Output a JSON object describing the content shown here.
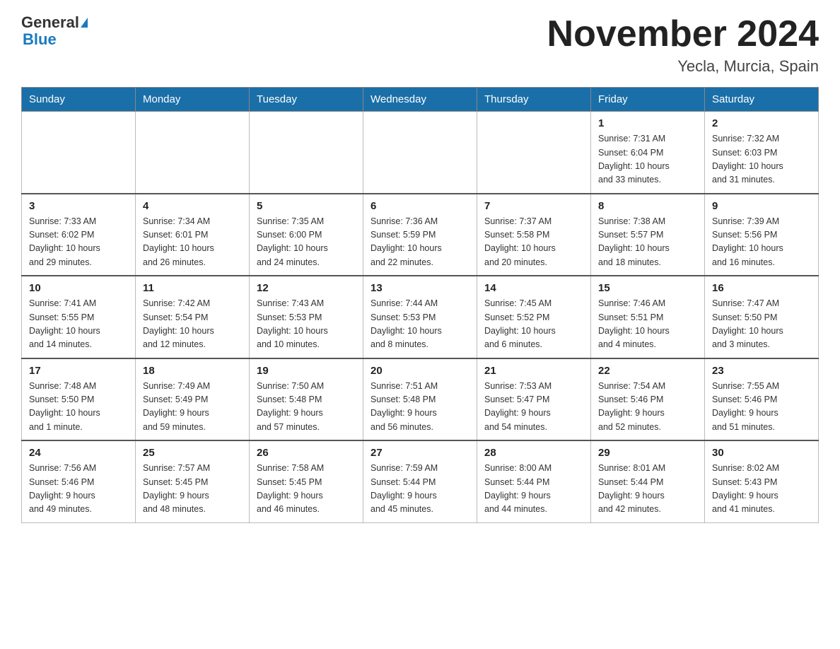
{
  "header": {
    "logo_general": "General",
    "logo_blue": "Blue",
    "month_title": "November 2024",
    "location": "Yecla, Murcia, Spain"
  },
  "weekdays": [
    "Sunday",
    "Monday",
    "Tuesday",
    "Wednesday",
    "Thursday",
    "Friday",
    "Saturday"
  ],
  "weeks": [
    [
      {
        "day": "",
        "info": ""
      },
      {
        "day": "",
        "info": ""
      },
      {
        "day": "",
        "info": ""
      },
      {
        "day": "",
        "info": ""
      },
      {
        "day": "",
        "info": ""
      },
      {
        "day": "1",
        "info": "Sunrise: 7:31 AM\nSunset: 6:04 PM\nDaylight: 10 hours\nand 33 minutes."
      },
      {
        "day": "2",
        "info": "Sunrise: 7:32 AM\nSunset: 6:03 PM\nDaylight: 10 hours\nand 31 minutes."
      }
    ],
    [
      {
        "day": "3",
        "info": "Sunrise: 7:33 AM\nSunset: 6:02 PM\nDaylight: 10 hours\nand 29 minutes."
      },
      {
        "day": "4",
        "info": "Sunrise: 7:34 AM\nSunset: 6:01 PM\nDaylight: 10 hours\nand 26 minutes."
      },
      {
        "day": "5",
        "info": "Sunrise: 7:35 AM\nSunset: 6:00 PM\nDaylight: 10 hours\nand 24 minutes."
      },
      {
        "day": "6",
        "info": "Sunrise: 7:36 AM\nSunset: 5:59 PM\nDaylight: 10 hours\nand 22 minutes."
      },
      {
        "day": "7",
        "info": "Sunrise: 7:37 AM\nSunset: 5:58 PM\nDaylight: 10 hours\nand 20 minutes."
      },
      {
        "day": "8",
        "info": "Sunrise: 7:38 AM\nSunset: 5:57 PM\nDaylight: 10 hours\nand 18 minutes."
      },
      {
        "day": "9",
        "info": "Sunrise: 7:39 AM\nSunset: 5:56 PM\nDaylight: 10 hours\nand 16 minutes."
      }
    ],
    [
      {
        "day": "10",
        "info": "Sunrise: 7:41 AM\nSunset: 5:55 PM\nDaylight: 10 hours\nand 14 minutes."
      },
      {
        "day": "11",
        "info": "Sunrise: 7:42 AM\nSunset: 5:54 PM\nDaylight: 10 hours\nand 12 minutes."
      },
      {
        "day": "12",
        "info": "Sunrise: 7:43 AM\nSunset: 5:53 PM\nDaylight: 10 hours\nand 10 minutes."
      },
      {
        "day": "13",
        "info": "Sunrise: 7:44 AM\nSunset: 5:53 PM\nDaylight: 10 hours\nand 8 minutes."
      },
      {
        "day": "14",
        "info": "Sunrise: 7:45 AM\nSunset: 5:52 PM\nDaylight: 10 hours\nand 6 minutes."
      },
      {
        "day": "15",
        "info": "Sunrise: 7:46 AM\nSunset: 5:51 PM\nDaylight: 10 hours\nand 4 minutes."
      },
      {
        "day": "16",
        "info": "Sunrise: 7:47 AM\nSunset: 5:50 PM\nDaylight: 10 hours\nand 3 minutes."
      }
    ],
    [
      {
        "day": "17",
        "info": "Sunrise: 7:48 AM\nSunset: 5:50 PM\nDaylight: 10 hours\nand 1 minute."
      },
      {
        "day": "18",
        "info": "Sunrise: 7:49 AM\nSunset: 5:49 PM\nDaylight: 9 hours\nand 59 minutes."
      },
      {
        "day": "19",
        "info": "Sunrise: 7:50 AM\nSunset: 5:48 PM\nDaylight: 9 hours\nand 57 minutes."
      },
      {
        "day": "20",
        "info": "Sunrise: 7:51 AM\nSunset: 5:48 PM\nDaylight: 9 hours\nand 56 minutes."
      },
      {
        "day": "21",
        "info": "Sunrise: 7:53 AM\nSunset: 5:47 PM\nDaylight: 9 hours\nand 54 minutes."
      },
      {
        "day": "22",
        "info": "Sunrise: 7:54 AM\nSunset: 5:46 PM\nDaylight: 9 hours\nand 52 minutes."
      },
      {
        "day": "23",
        "info": "Sunrise: 7:55 AM\nSunset: 5:46 PM\nDaylight: 9 hours\nand 51 minutes."
      }
    ],
    [
      {
        "day": "24",
        "info": "Sunrise: 7:56 AM\nSunset: 5:46 PM\nDaylight: 9 hours\nand 49 minutes."
      },
      {
        "day": "25",
        "info": "Sunrise: 7:57 AM\nSunset: 5:45 PM\nDaylight: 9 hours\nand 48 minutes."
      },
      {
        "day": "26",
        "info": "Sunrise: 7:58 AM\nSunset: 5:45 PM\nDaylight: 9 hours\nand 46 minutes."
      },
      {
        "day": "27",
        "info": "Sunrise: 7:59 AM\nSunset: 5:44 PM\nDaylight: 9 hours\nand 45 minutes."
      },
      {
        "day": "28",
        "info": "Sunrise: 8:00 AM\nSunset: 5:44 PM\nDaylight: 9 hours\nand 44 minutes."
      },
      {
        "day": "29",
        "info": "Sunrise: 8:01 AM\nSunset: 5:44 PM\nDaylight: 9 hours\nand 42 minutes."
      },
      {
        "day": "30",
        "info": "Sunrise: 8:02 AM\nSunset: 5:43 PM\nDaylight: 9 hours\nand 41 minutes."
      }
    ]
  ]
}
